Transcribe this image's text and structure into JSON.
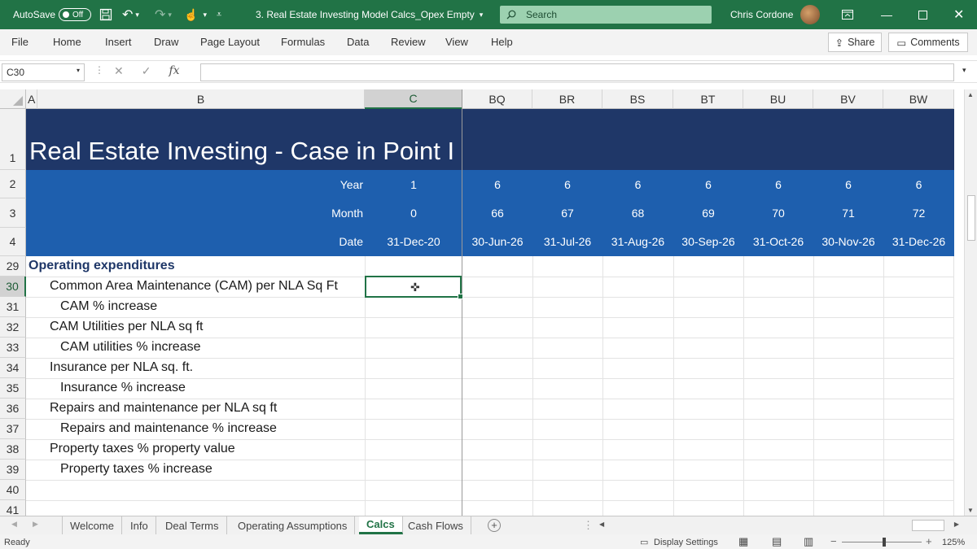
{
  "titlebar": {
    "autosave_label": "AutoSave",
    "autosave_state": "Off",
    "document_title": "3. Real Estate Investing Model Calcs_Opex Empty",
    "search_placeholder": "Search",
    "user_name": "Chris Cordone"
  },
  "ribbon": {
    "tabs": [
      "File",
      "Home",
      "Insert",
      "Draw",
      "Page Layout",
      "Formulas",
      "Data",
      "Review",
      "View",
      "Help"
    ],
    "share_label": "Share",
    "comments_label": "Comments"
  },
  "formula_bar": {
    "name_box": "C30",
    "fx": "fx",
    "content": ""
  },
  "sheet": {
    "columns": [
      "A",
      "B",
      "C",
      "BQ",
      "BR",
      "BS",
      "BT",
      "BU",
      "BV",
      "BW"
    ],
    "rows": [
      "1",
      "2",
      "3",
      "4",
      "29",
      "30",
      "31",
      "32",
      "33",
      "34",
      "35",
      "36",
      "37",
      "38",
      "39",
      "40",
      "41"
    ],
    "title": "Real Estate Investing - Case in Point I",
    "header_rows": [
      {
        "label": "Year",
        "c": "1",
        "values": [
          "6",
          "6",
          "6",
          "6",
          "6",
          "6",
          "6"
        ]
      },
      {
        "label": "Month",
        "c": "0",
        "values": [
          "66",
          "67",
          "68",
          "69",
          "70",
          "71",
          "72"
        ]
      },
      {
        "label": "Date",
        "c": "31-Dec-20",
        "values": [
          "30-Jun-26",
          "31-Jul-26",
          "31-Aug-26",
          "30-Sep-26",
          "31-Oct-26",
          "30-Nov-26",
          "31-Dec-26"
        ]
      }
    ],
    "section_title": "Operating expenditures",
    "items": [
      "Common Area Maintenance (CAM) per NLA Sq Ft",
      "CAM % increase",
      "CAM Utilities per NLA sq ft",
      "CAM utilities % increase",
      "Insurance per NLA sq. ft.",
      "Insurance % increase",
      "Repairs and maintenance per NLA sq ft",
      "Repairs and maintenance % increase",
      "Property taxes % property value",
      "Property taxes % increase"
    ]
  },
  "sheet_tabs": [
    "Welcome",
    "Info",
    "Deal Terms",
    "Operating Assumptions",
    "Calcs",
    "Cash Flows"
  ],
  "active_tab": "Calcs",
  "status": {
    "ready": "Ready",
    "display_settings": "Display Settings",
    "zoom": "125%"
  },
  "colors": {
    "excel_green": "#217346",
    "title_band": "#1f3768",
    "header_band": "#1e5fae"
  }
}
